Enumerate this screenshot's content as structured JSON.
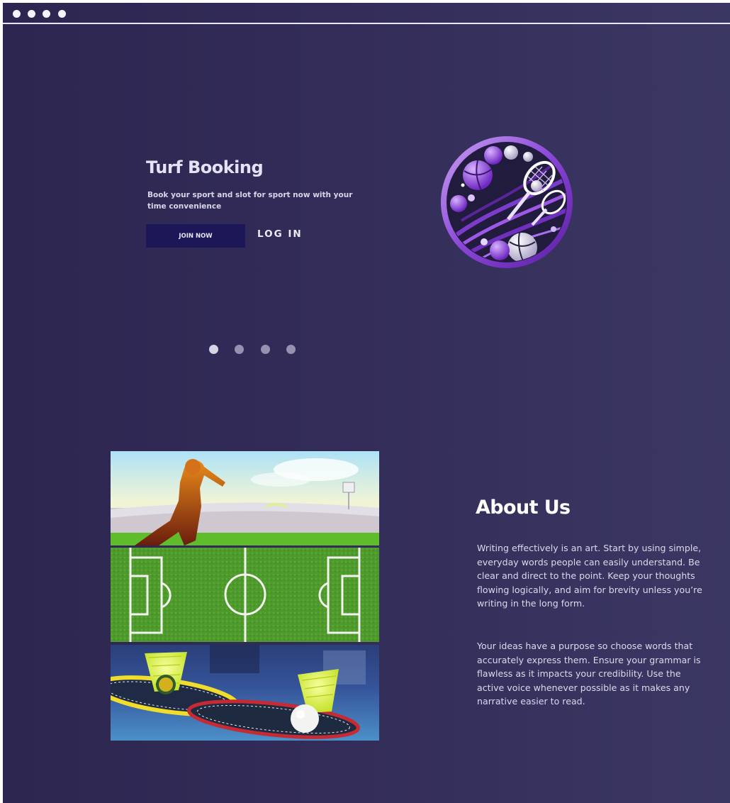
{
  "hero": {
    "title": "Turf Booking",
    "subtitle": "Book your sport  and slot for sport now with your time convenience",
    "join_label": "JOIN NOW",
    "login_label": "LOG IN"
  },
  "carousel": {
    "slide_count": 4,
    "active_index": 0
  },
  "gallery": {
    "images": [
      "cricket-batsman-image",
      "football-field-image",
      "badminton-shuttlecock-image"
    ]
  },
  "about": {
    "title": "About Us",
    "paragraph_1": "Writing effectively is an art. Start by using simple, everyday words people can easily understand. Be clear and direct to the point. Keep your thoughts flowing logically, and aim for brevity unless you’re writing in the long form.",
    "paragraph_2": "Your ideas have a purpose so choose words that accurately express them. Ensure your grammar is flawless as it impacts your credibility. Use the active voice whenever possible as it makes any narrative easier to read."
  },
  "colors": {
    "background": "#2c2650",
    "button": "#1c1757",
    "accent": "#8a45d6"
  }
}
